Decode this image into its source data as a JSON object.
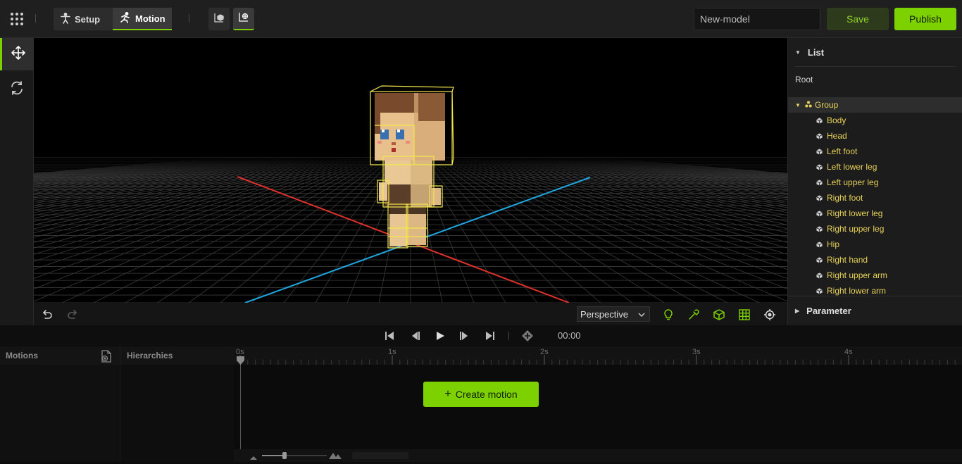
{
  "topbar": {
    "modes": [
      {
        "label": "Setup",
        "icon": "person-icon"
      },
      {
        "label": "Motion",
        "icon": "running-person-icon"
      }
    ],
    "active_mode": "Motion",
    "view_buttons": [
      "model-view-icon",
      "world-view-icon"
    ],
    "model_name": "New-model",
    "save_label": "Save",
    "publish_label": "Publish"
  },
  "tools": [
    "move-icon",
    "rotate-icon"
  ],
  "viewport_toolbar": {
    "camera_mode": "Perspective",
    "icons": [
      "undo-icon",
      "redo-icon",
      "light-icon",
      "pick-color-icon",
      "bounding-box-icon",
      "grid-icon",
      "focus-target-icon"
    ]
  },
  "right_panel": {
    "list_title": "List",
    "root_label": "Root",
    "group_label": "Group",
    "items": [
      "Body",
      "Head",
      "Left foot",
      "Left lower leg",
      "Left upper leg",
      "Right foot",
      "Right lower leg",
      "Right upper leg",
      "Hip",
      "Right hand",
      "Right upper arm",
      "Right lower arm"
    ],
    "parameter_title": "Parameter"
  },
  "transport": {
    "time": "00:00",
    "icons": [
      "skip-start-icon",
      "step-back-icon",
      "play-icon",
      "step-forward-icon",
      "skip-end-icon",
      "keyframe-icon"
    ]
  },
  "bottom": {
    "motions_title": "Motions",
    "hierarchies_title": "Hierarchies",
    "timeline_seconds": [
      "0s",
      "1s",
      "2s",
      "3s",
      "4s"
    ],
    "create_motion_label": "Create motion"
  },
  "colors": {
    "accent": "#7ed100",
    "item_text": "#e8d35a",
    "x_axis": "#e0322a",
    "z_axis": "#1fa6e0"
  }
}
